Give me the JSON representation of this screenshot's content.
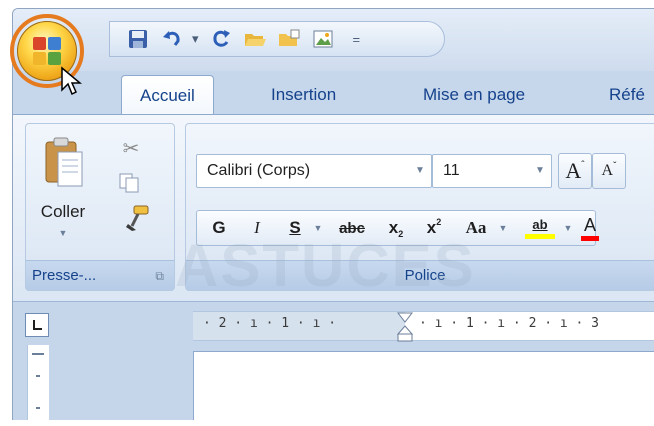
{
  "tabs": [
    {
      "label": "Accueil",
      "active": true
    },
    {
      "label": "Insertion",
      "active": false
    },
    {
      "label": "Mise en page",
      "active": false
    },
    {
      "label": "Réfé",
      "active": false
    }
  ],
  "clipboard": {
    "paste_label": "Coller",
    "group_label": "Presse-...",
    "icons": [
      "paste-icon",
      "cut-icon",
      "copy-icon",
      "format-painter-icon"
    ]
  },
  "font": {
    "group_label": "Police",
    "font_name": "Calibri (Corps)",
    "font_size": "11",
    "grow": "A",
    "shrink": "A",
    "bold": "G",
    "italic": "I",
    "underline": "S",
    "strike": "abc",
    "subscript": "x",
    "superscript": "x",
    "change_case": "Aa",
    "highlight": "ab"
  },
  "quick_access": {
    "icons": [
      "save-icon",
      "undo-icon",
      "redo-icon",
      "open-folder-icon",
      "new-folder-icon",
      "image-icon"
    ],
    "separator_glyph": "▾"
  },
  "ruler": {
    "left_marks": "· 2 · ı · 1 · ı ·",
    "right_marks": "· ı · 1 · ı · 2 · ı · 3"
  },
  "watermark": "ASTUCES",
  "colors": {
    "accent_blue": "#15428b",
    "office_ring": "#e57a1f",
    "highlight_yellow": "#ffff00",
    "font_red": "#ff0000"
  }
}
